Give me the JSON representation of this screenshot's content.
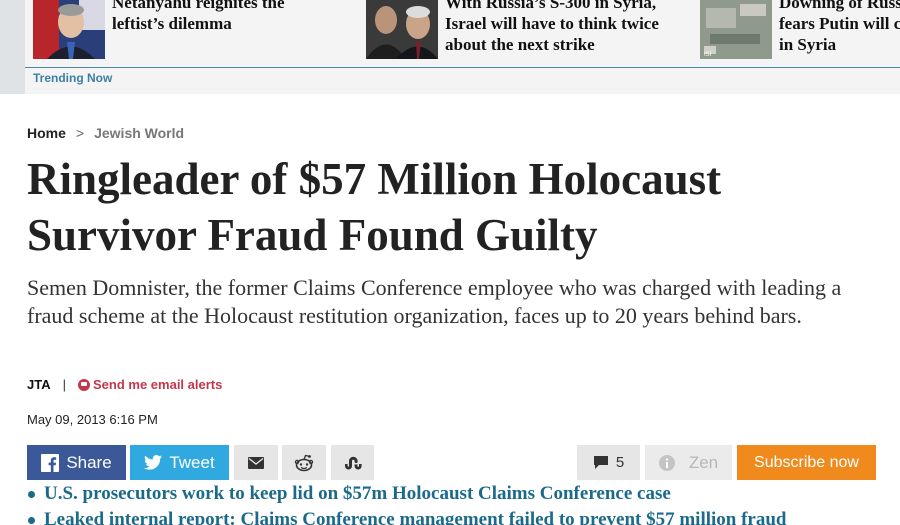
{
  "trending": {
    "items": [
      {
        "title_line1": "Netanyahu reignites the",
        "title_line2": "leftist’s dilemma"
      },
      {
        "title_line1": "With Russia’s S-300 in Syria,",
        "title_line2": "Israel will have to think twice",
        "title_line3": "about the next strike"
      },
      {
        "title_line1": "Downing of Russ",
        "title_line2": "fears Putin will c",
        "title_line3": "in Syria"
      }
    ],
    "label": "Trending Now"
  },
  "breadcrumb": {
    "home": "Home",
    "separator": ">",
    "section": "Jewish World"
  },
  "article": {
    "headline": "Ringleader of $57 Million Holocaust Survivor Fraud Found Guilty",
    "subtitle": "Semen Domnister, the former Claims Conference employee who was charged with leading a fraud scheme at the Holocaust restitution organization, faces up to 20 years behind bars.",
    "source": "JTA",
    "byline_separator": "|",
    "email_alert": "Send me email alerts",
    "date": "May 09, 2013 6:16 PM"
  },
  "share_bar": {
    "facebook_label": "Share",
    "twitter_label": "Tweet",
    "comments_count": "5",
    "zen_label": "Zen",
    "subscribe_label": "Subscribe now"
  },
  "related": [
    "U.S. prosecutors work to keep lid on $57m Holocaust Claims Conference case",
    "Leaked internal report: Claims Conference management failed to prevent $57 million fraud"
  ],
  "colors": {
    "facebook": "#3b5998",
    "twitter": "#2fa9e0",
    "subscribe": "#f08a1c",
    "link": "#1b6a8a",
    "alert": "#c2384a"
  }
}
